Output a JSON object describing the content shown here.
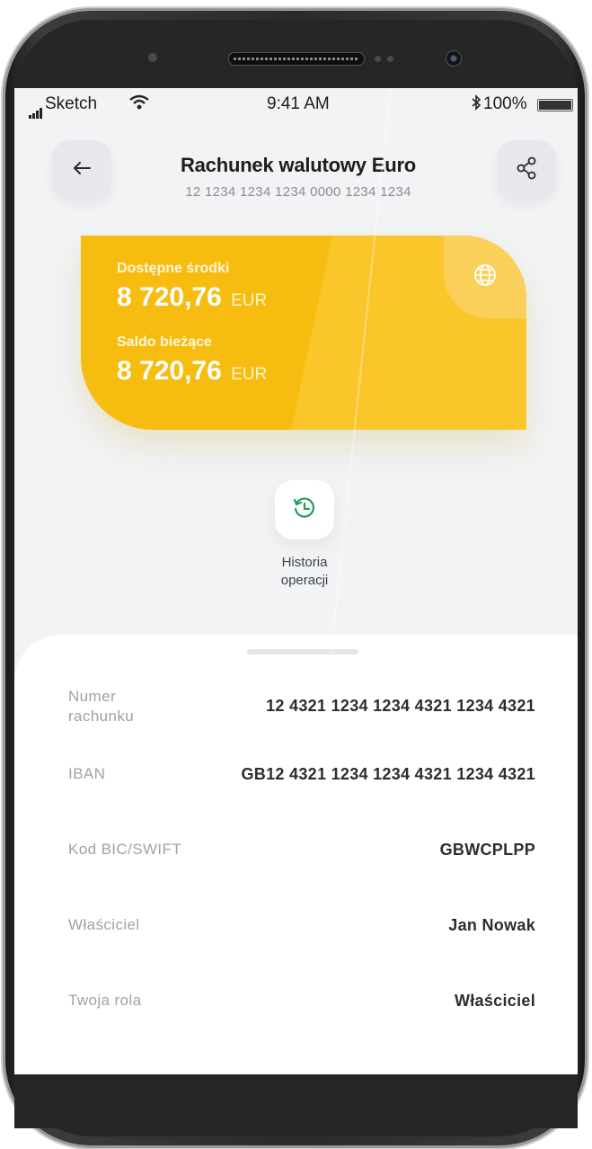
{
  "status_bar": {
    "carrier": "Sketch",
    "time": "9:41 AM",
    "battery": "100%"
  },
  "header": {
    "title": "Rachunek walutowy Euro",
    "account_number": "12 1234 1234 1234 0000 1234 1234"
  },
  "card": {
    "available_label": "Dostępne środki",
    "available_amount": "8 720,76",
    "available_currency": "EUR",
    "balance_label": "Saldo bieżące",
    "balance_amount": "8 720,76",
    "balance_currency": "EUR",
    "color": "#f7bc10"
  },
  "actions": {
    "history_line1": "Historia",
    "history_line2": "operacji"
  },
  "details": {
    "account_number_label_1": "Numer",
    "account_number_label_2": "rachunku",
    "account_number_value": "12 4321 1234 1234 4321 1234 4321",
    "iban_label": "IBAN",
    "iban_value": "GB12 4321 1234 1234 4321 1234 4321",
    "bic_label": "Kod BIC/SWIFT",
    "bic_value": "GBWCPLPP",
    "owner_label": "Właściciel",
    "owner_value": "Jan Nowak",
    "role_label": "Twoja rola",
    "role_value": "Właściciel"
  },
  "icons": {
    "back": "arrow-left-icon",
    "share": "share-icon",
    "globe": "globe-icon",
    "history": "history-icon"
  }
}
